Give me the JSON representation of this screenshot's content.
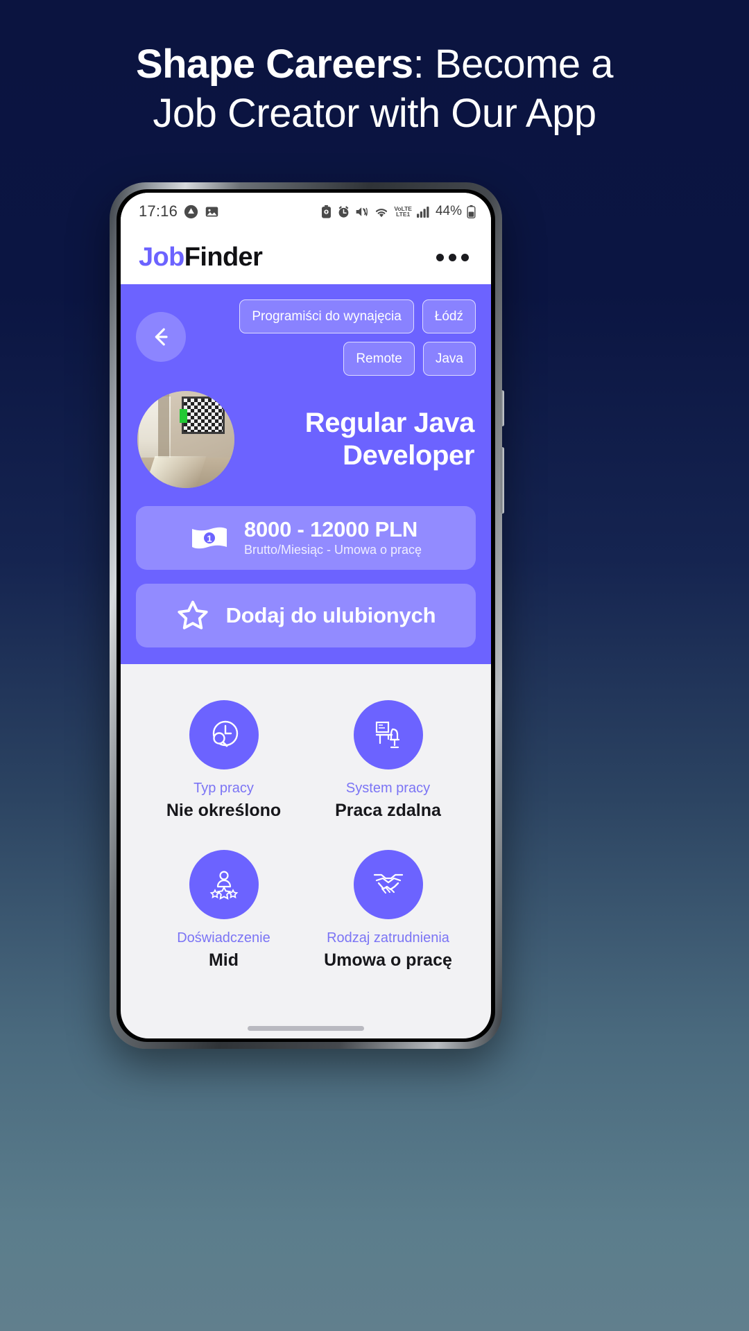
{
  "promo": {
    "line1_strong": "Shape Careers",
    "line1_rest": ": Become a",
    "line2": "Job Creator with Our App"
  },
  "phone": {
    "statusbar": {
      "time": "17:16",
      "icons_left": [
        "app-badge-icon",
        "photo-icon"
      ],
      "icons_right": [
        "battery-saver-icon",
        "alarm-icon",
        "mute-icon",
        "wifi-icon"
      ],
      "network_label_top": "VoLTE",
      "network_label_bottom": "LTE1",
      "signal": "signal-bars-icon",
      "battery": "44%"
    },
    "appbar": {
      "brand_first": "Job",
      "brand_second": "Finder",
      "menu": "overflow-menu-icon"
    },
    "hero": {
      "back": "back-arrow-icon",
      "chips": [
        "Programiści do wynajęcia",
        "Łódź",
        "Remote",
        "Java"
      ],
      "job_title_line1": "Regular Java",
      "job_title_line2": "Developer",
      "salary": {
        "icon": "banknote-icon",
        "amount": "8000 - 12000 PLN",
        "details": "Brutto/Miesiąc - Umowa o pracę"
      },
      "favorite": {
        "icon": "star-outline-icon",
        "label": "Dodaj do ulubionych"
      }
    },
    "details": [
      {
        "icon": "clock-search-icon",
        "label": "Typ pracy",
        "value": "Nie określono"
      },
      {
        "icon": "desk-chair-icon",
        "label": "System pracy",
        "value": "Praca zdalna"
      },
      {
        "icon": "person-stars-icon",
        "label": "Doświadczenie",
        "value": "Mid"
      },
      {
        "icon": "handshake-icon",
        "label": "Rodzaj zatrudnienia",
        "value": "Umowa o pracę"
      }
    ]
  },
  "colors": {
    "brand_purple": "#6c63ff",
    "background_navy": "#0b1440",
    "screen_bg": "#f2f2f4"
  }
}
